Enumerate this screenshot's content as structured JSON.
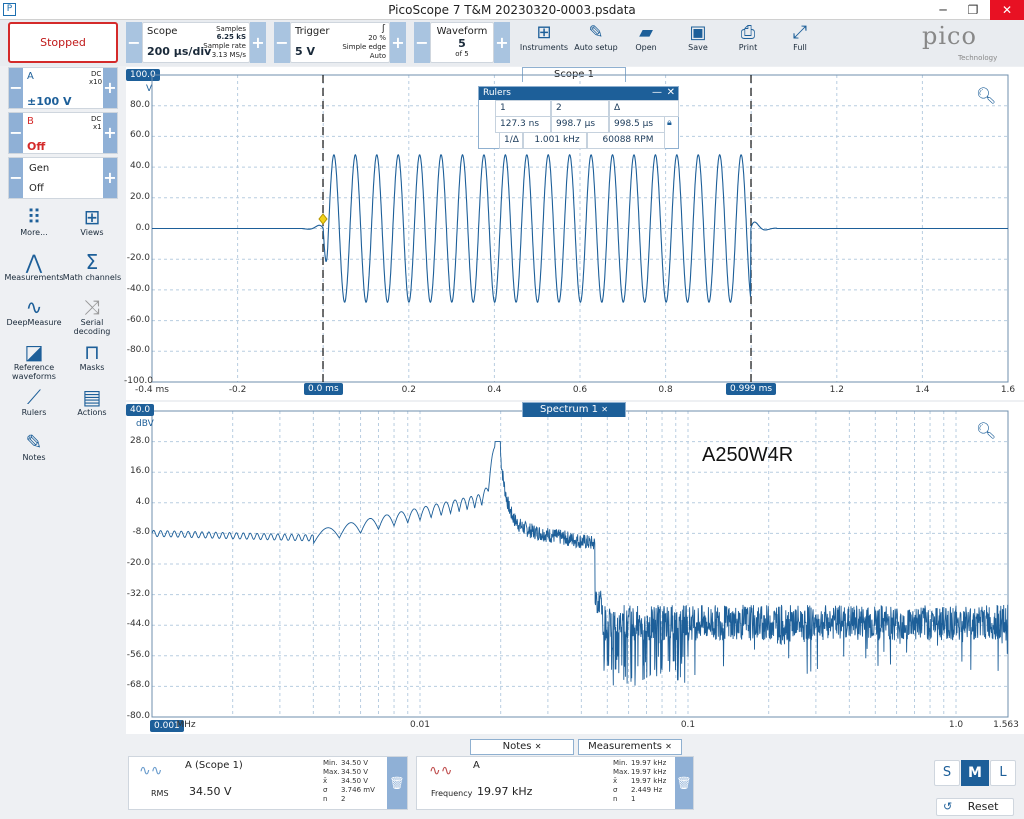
{
  "window": {
    "title": "PicoScope 7 T&M 20230320-0003.psdata",
    "app_icon": "P"
  },
  "toolbar": {
    "stop_label": "Stopped",
    "scope": {
      "label": "Scope",
      "timebase": "200 µs/div",
      "samples_label": "Samples",
      "samples": "6.25 kS",
      "rate_label": "Sample rate",
      "rate": "3.13 MS/s"
    },
    "trigger": {
      "label": "Trigger",
      "level": "5 V",
      "pct": "20 %",
      "type": "Simple edge",
      "mode": "Auto"
    },
    "waveform": {
      "label": "Waveform",
      "current": "5",
      "of": "of 5"
    },
    "buttons": [
      {
        "label": "Instruments",
        "icon": "instruments-icon",
        "glyph": "⊞"
      },
      {
        "label": "Auto setup",
        "icon": "auto-setup-icon",
        "glyph": "✎"
      },
      {
        "label": "Open",
        "icon": "folder-icon",
        "glyph": "▰"
      },
      {
        "label": "Save",
        "icon": "save-icon",
        "glyph": "▣"
      },
      {
        "label": "Print",
        "icon": "print-icon",
        "glyph": "⎙"
      },
      {
        "label": "Full",
        "icon": "fullscreen-icon",
        "glyph": "⤢"
      }
    ],
    "logo_main": "pico",
    "logo_sub": "Technology"
  },
  "channels": [
    {
      "name": "A",
      "coupling": "DC",
      "probe": "x10",
      "range": "±100 V",
      "color": "#1d5f99"
    },
    {
      "name": "B",
      "coupling": "DC",
      "probe": "x1",
      "range": "Off",
      "color": "#d42a2a"
    },
    {
      "name": "Gen",
      "range": "Off",
      "color": "#333333"
    }
  ],
  "sidebar": [
    {
      "label": "More...",
      "icon": "more-dots-icon",
      "glyph": "⠿"
    },
    {
      "label": "Views",
      "icon": "views-grid-icon",
      "glyph": "⊞"
    },
    {
      "label": "Measurements",
      "icon": "measurements-icon",
      "glyph": "⋀"
    },
    {
      "label": "Math channels",
      "icon": "sigma-icon",
      "glyph": "Σ"
    },
    {
      "label": "DeepMeasure",
      "icon": "deepmeasure-icon",
      "glyph": "∿"
    },
    {
      "label": "Serial decoding",
      "icon": "serial-decoding-icon",
      "glyph": "⤨"
    },
    {
      "label": "Reference waveforms",
      "icon": "reference-icon",
      "glyph": "◪"
    },
    {
      "label": "Masks",
      "icon": "masks-icon",
      "glyph": "⊓"
    },
    {
      "label": "Rulers",
      "icon": "ruler-icon",
      "glyph": "⟋"
    },
    {
      "label": "Actions",
      "icon": "actions-icon",
      "glyph": "▤"
    },
    {
      "label": "Notes",
      "icon": "notes-icon",
      "glyph": "✎"
    }
  ],
  "scope": {
    "tab": "Scope 1",
    "unit": "V",
    "yticks": [
      "100.0",
      "80.0",
      "60.0",
      "40.0",
      "20.0",
      "0.0",
      "-20.0",
      "-40.0",
      "-60.0",
      "-80.0",
      "-100.0"
    ],
    "xticks": [
      "-0.4 ms",
      "-0.2",
      "0.0 ms",
      "0.2",
      "0.4",
      "0.6",
      "0.8",
      "0.999 ms",
      "1.2",
      "1.4",
      "1.6"
    ],
    "ruler1_label": "0.0 ms",
    "ruler2_label": "0.999 ms"
  },
  "rulers": {
    "title": "Rulers",
    "col1": "1",
    "col2": "2",
    "col3": "Δ",
    "v1": "127.3 ns",
    "v2": "998.7 µs",
    "v3": "998.5 µs",
    "inv_label": "1/Δ",
    "freq": "1.001 kHz",
    "rpm": "60088 RPM"
  },
  "spectrum": {
    "tab": "Spectrum 1",
    "unit": "dBV",
    "yticks": [
      "40.0",
      "28.0",
      "16.0",
      "4.0",
      "-8.0",
      "-20.0",
      "-32.0",
      "-44.0",
      "-56.0",
      "-68.0",
      "-80.0"
    ],
    "xticks": [
      "0.001",
      "MHz",
      "0.01",
      "0.1",
      "1.0",
      "1.563"
    ],
    "annotation": "A250W4R"
  },
  "bottom": {
    "notes_tab": "Notes",
    "meas_tab": "Measurements",
    "m1": {
      "channel": "A (Scope 1)",
      "type": "RMS",
      "value": "34.50 V",
      "min_label": "Min.",
      "min": "34.50 V",
      "max_label": "Max.",
      "max": "34.50 V",
      "mean_label": "x̄",
      "mean": "34.50 V",
      "sd_label": "σ",
      "sd": "3.746 mV",
      "n_label": "n",
      "n": "2"
    },
    "m2": {
      "channel": "A",
      "type": "Frequency",
      "value": "19.97 kHz",
      "min_label": "Min.",
      "min": "19.97 kHz",
      "max_label": "Max.",
      "max": "19.97 kHz",
      "mean_label": "x̄",
      "mean": "19.97 kHz",
      "sd_label": "σ",
      "sd": "2.449 Hz",
      "n_label": "n",
      "n": "1"
    },
    "size_s": "S",
    "size_m": "M",
    "size_l": "L",
    "reset": "Reset"
  }
}
